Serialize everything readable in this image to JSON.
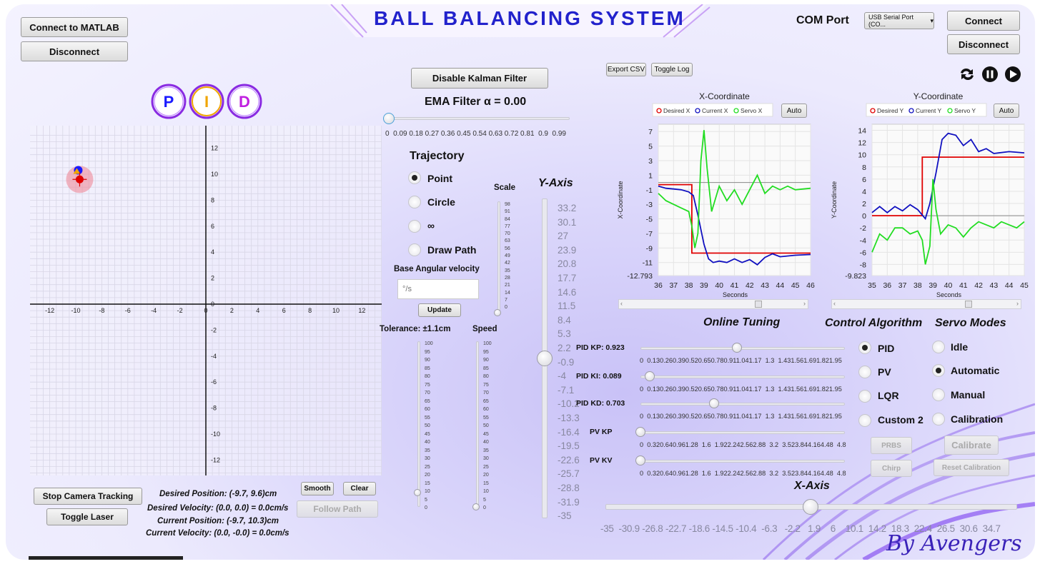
{
  "app": {
    "title": "BALL BALANCING SYSTEM",
    "signature": "By Avengers"
  },
  "matlab": {
    "connect_label": "Connect to MATLAB",
    "disconnect_label": "Disconnect"
  },
  "com": {
    "label": "COM Port",
    "port_value": "USB Serial Port (CO...",
    "connect_label": "Connect",
    "disconnect_label": "Disconnect"
  },
  "pid_badges": [
    "P",
    "I",
    "D"
  ],
  "kalman": {
    "button_label": "Disable Kalman Filter"
  },
  "ema": {
    "label": "EMA Filter α = 0.00",
    "value": 0.0,
    "ticks": "0  0.09 0.18 0.27 0.36 0.45 0.54 0.63 0.72 0.81  0.9  0.99"
  },
  "trajectory": {
    "title": "Trajectory",
    "options": [
      "Point",
      "Circle",
      "∞",
      "Draw Path"
    ],
    "selected": "Point",
    "base_velocity_label": "Base Angular velocity",
    "base_velocity_placeholder": "°/s",
    "update_label": "Update",
    "scale_label": "Scale",
    "scale_ticks": "98\n91\n84\n77\n70\n63\n56\n49\n42\n35\n28\n21\n14\n7\n0",
    "tolerance_label": "Tolerance: ±1.1cm",
    "speed_label": "Speed",
    "percent_ticks": "100\n95\n90\n85\n80\n75\n70\n65\n60\n55\n50\n45\n40\n35\n30\n25\n20\n15\n10\n5\n0"
  },
  "y_axis": {
    "title": "Y-Axis",
    "ticks": [
      "33.2",
      "30.1",
      "27",
      "23.9",
      "20.8",
      "17.7",
      "14.6",
      "11.5",
      "8.4",
      "5.3",
      "2.2",
      "-0.9",
      "-4",
      "-7.1",
      "-10.2",
      "-13.3",
      "-16.4",
      "-19.5",
      "-22.6",
      "-25.7",
      "-28.8",
      "-31.9",
      "-35"
    ]
  },
  "x_axis": {
    "title": "X-Axis",
    "ticks": "-35  -30.9 -26.8 -22.7 -18.6 -14.5 -10.4  -6.3   -2.2   1.9    6    10.1  14.2  18.3  22.4  26.5  30.6  34.7"
  },
  "plot": {
    "x_ticks": [
      "-12",
      "-10",
      "-8",
      "-6",
      "-4",
      "-2",
      "0",
      "2",
      "4",
      "6",
      "8",
      "10",
      "12"
    ],
    "y_ticks": [
      "12",
      "10",
      "8",
      "6",
      "4",
      "2",
      "0",
      "-2",
      "-4",
      "-6",
      "-8",
      "-10",
      "-12"
    ]
  },
  "camera": {
    "stop_label": "Stop Camera Tracking",
    "laser_label": "Toggle Laser"
  },
  "path": {
    "smooth_label": "Smooth",
    "clear_label": "Clear",
    "follow_label": "Follow Path"
  },
  "status": {
    "desired_position": "Desired Position: (-9.7, 9.6)cm",
    "desired_velocity": "Desired Velocity: (0.0, 0.0) = 0.0cm/s",
    "current_position": "Current Position: (-9.7, 10.3)cm",
    "current_velocity": "Current Velocity: (0.0, -0.0) = 0.0cm/s"
  },
  "toolbar": {
    "export_label": "Export CSV",
    "log_label": "Toggle Log"
  },
  "charts": {
    "x": {
      "title": "X-Coordinate",
      "ylabel": "X-Coordinate",
      "xlabel": "Seconds",
      "auto_label": "Auto",
      "legend": [
        "Desired X",
        "Current X",
        "Servo X"
      ],
      "y_ticks": [
        "7",
        "5",
        "3",
        "1",
        "-1",
        "-3",
        "-5",
        "-7",
        "-9",
        "-11",
        "-12.793"
      ],
      "x_ticks": [
        "36",
        "37",
        "38",
        "39",
        "40",
        "41",
        "42",
        "43",
        "44",
        "45",
        "46"
      ]
    },
    "y": {
      "title": "Y-Coordinate",
      "ylabel": "Y-Coordinate",
      "xlabel": "Seconds",
      "auto_label": "Auto",
      "legend": [
        "Desired Y",
        "Current Y",
        "Servo Y"
      ],
      "y_ticks": [
        "14",
        "12",
        "10",
        "8",
        "6",
        "4",
        "2",
        "0",
        "-2",
        "-4",
        "-6",
        "-8",
        "-9.823"
      ],
      "x_ticks": [
        "35",
        "36",
        "37",
        "38",
        "39",
        "40",
        "41",
        "42",
        "43",
        "44",
        "45"
      ]
    }
  },
  "chart_data": [
    {
      "type": "line",
      "title": "X-Coordinate",
      "xlabel": "Seconds",
      "ylabel": "X-Coordinate",
      "xlim": [
        36,
        46
      ],
      "ylim": [
        -12.793,
        8
      ],
      "series": [
        {
          "name": "Desired X",
          "color": "#e00000",
          "x": [
            36,
            38.2,
            38.2,
            46
          ],
          "values": [
            -0.3,
            -0.3,
            -9.7,
            -9.7
          ]
        },
        {
          "name": "Current X",
          "color": "#1010c0",
          "x": [
            36,
            36.5,
            37,
            37.5,
            38,
            38.3,
            38.6,
            39,
            39.3,
            39.6,
            40,
            40.5,
            41,
            41.5,
            42,
            42.5,
            43,
            43.5,
            44,
            45,
            46
          ],
          "values": [
            -0.5,
            -0.8,
            -0.9,
            -1.0,
            -1.3,
            -1.8,
            -4.5,
            -8.5,
            -10.5,
            -11.0,
            -10.8,
            -11.0,
            -10.5,
            -11.0,
            -10.6,
            -11.3,
            -10.3,
            -9.8,
            -10.2,
            -10.0,
            -9.9
          ]
        },
        {
          "name": "Servo X",
          "color": "#22dd22",
          "x": [
            36,
            36.5,
            37,
            37.5,
            38,
            38.2,
            38.4,
            38.6,
            38.8,
            39,
            39.2,
            39.5,
            40,
            40.5,
            41,
            41.5,
            42,
            42.5,
            43,
            43.5,
            44,
            44.5,
            45,
            46
          ],
          "values": [
            -1.5,
            -2.5,
            -3.0,
            -3.5,
            -4.0,
            -6,
            -9,
            -7,
            3,
            7.2,
            2,
            -4,
            -0.5,
            -2.5,
            -1,
            -3,
            -1,
            1,
            -1.5,
            -0.5,
            -1,
            -0.5,
            -1,
            -0.8
          ]
        }
      ]
    },
    {
      "type": "line",
      "title": "Y-Coordinate",
      "xlabel": "Seconds",
      "ylabel": "Y-Coordinate",
      "xlim": [
        35,
        45
      ],
      "ylim": [
        -9.823,
        15
      ],
      "series": [
        {
          "name": "Desired Y",
          "color": "#e00000",
          "x": [
            35,
            38.3,
            38.3,
            45
          ],
          "values": [
            0,
            0,
            9.6,
            9.6
          ]
        },
        {
          "name": "Current Y",
          "color": "#1010c0",
          "x": [
            35,
            35.5,
            36,
            36.5,
            37,
            37.5,
            38,
            38.5,
            38.8,
            39.2,
            39.6,
            40,
            40.5,
            41,
            41.5,
            42,
            42.5,
            43,
            44,
            45
          ],
          "values": [
            0.5,
            1.5,
            0.5,
            1.5,
            0.8,
            1.8,
            1.0,
            -0.5,
            2,
            7,
            12.5,
            13.5,
            13.2,
            11.5,
            12.5,
            10.5,
            11.0,
            10.2,
            10.5,
            10.3
          ]
        },
        {
          "name": "Servo Y",
          "color": "#22dd22",
          "x": [
            35,
            35.5,
            36,
            36.5,
            37,
            37.5,
            38,
            38.3,
            38.5,
            38.8,
            39,
            39.2,
            39.5,
            40,
            40.5,
            41,
            41.5,
            42,
            42.5,
            43,
            43.5,
            44,
            44.5,
            45
          ],
          "values": [
            -6,
            -3,
            -4,
            -2,
            -2,
            -3,
            -2.5,
            -4,
            -8,
            -5,
            6,
            1,
            -3,
            -1.5,
            -2,
            -3.5,
            -2,
            -1,
            -1.5,
            -2,
            -1,
            -1.5,
            -2,
            -1
          ]
        }
      ]
    }
  ],
  "tuning": {
    "title": "Online Tuning",
    "ticks_a": "0  0.130.260.390.520.650.780.911.041.17  1.3  1.431.561.691.821.95",
    "ticks_b": "0  0.320.640.961.28  1.6  1.922.242.562.88  3.2  3.523.844.164.48  4.8",
    "rows": [
      {
        "label": "PID KP: 0.923",
        "value": 0.923
      },
      {
        "label": "PID KI: 0.089",
        "value": 0.089
      },
      {
        "label": "PID KD: 0.703",
        "value": 0.703
      },
      {
        "label": "PV KP",
        "value": 0
      },
      {
        "label": "PV KV",
        "value": 0
      }
    ]
  },
  "control": {
    "title": "Control Algorithm",
    "options": [
      "PID",
      "PV",
      "LQR",
      "Custom 2"
    ],
    "selected": "PID",
    "prbs_label": "PRBS",
    "chirp_label": "Chirp"
  },
  "servo": {
    "title": "Servo Modes",
    "options": [
      "Idle",
      "Automatic",
      "Manual",
      "Calibration"
    ],
    "selected": "Automatic",
    "calibrate_label": "Calibrate",
    "reset_label": "Reset Calibration"
  },
  "colors": {
    "accent": "#7b4fe0",
    "p_badge": "#1a1aff",
    "i_badge": "#f0a500",
    "d_badge": "#c020e0"
  }
}
